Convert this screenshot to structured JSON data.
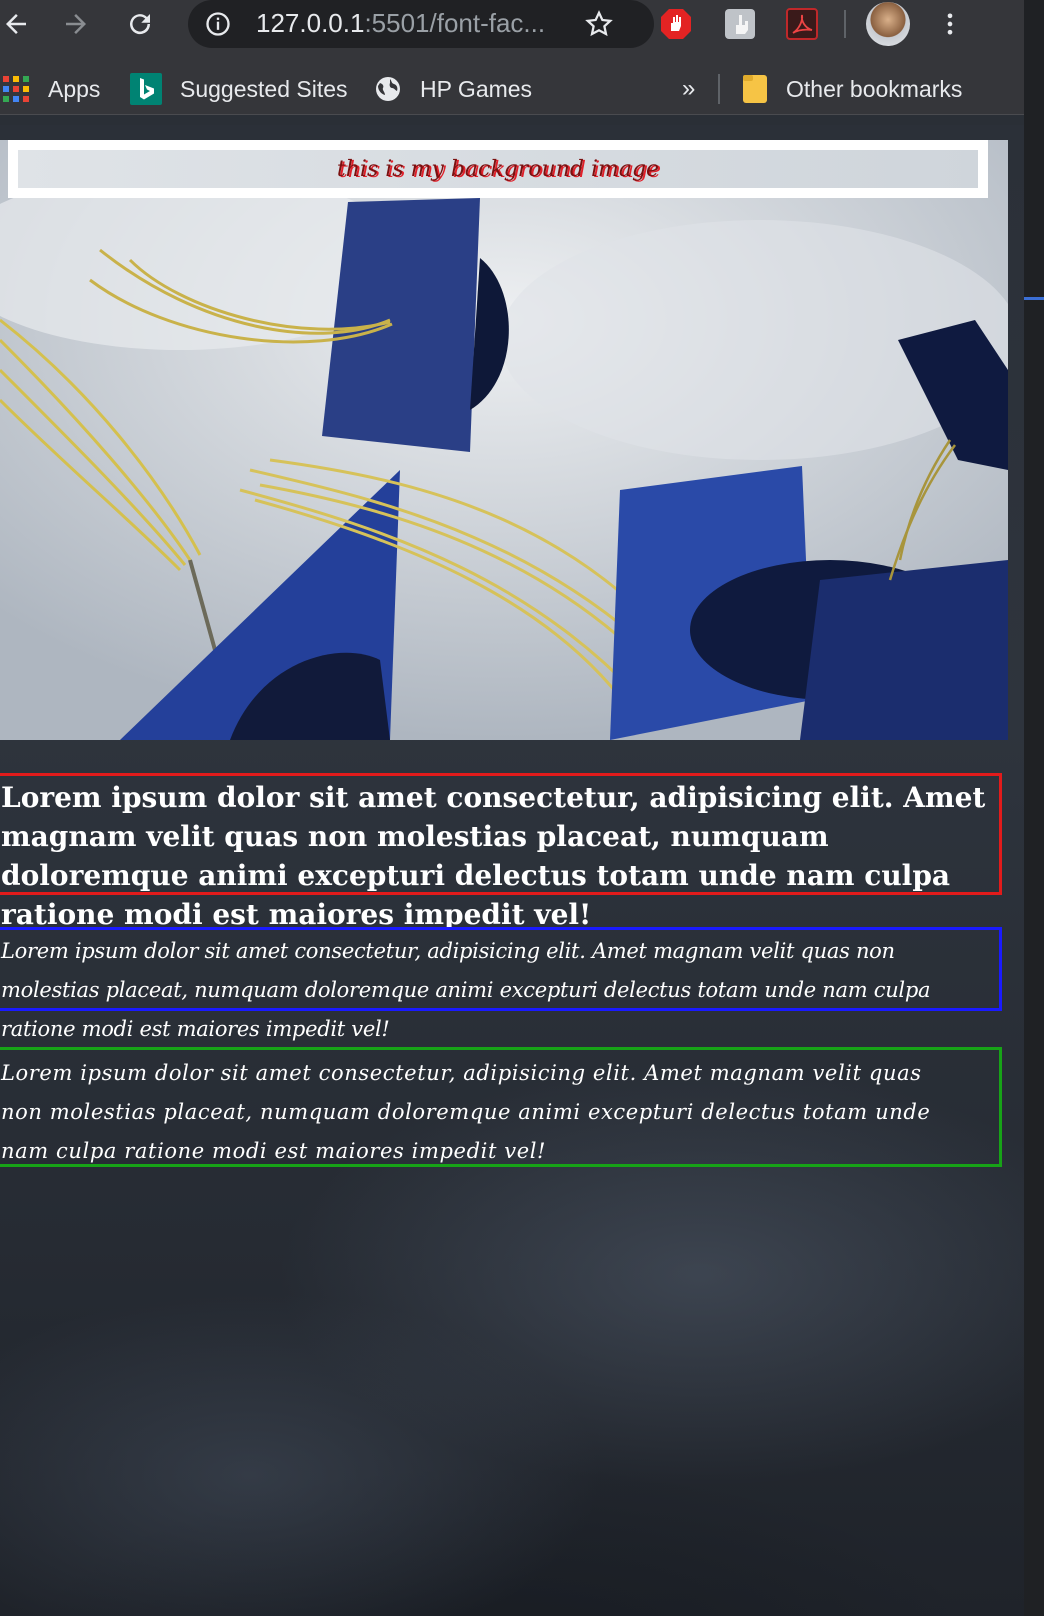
{
  "browser": {
    "url_host": "127.0.0.1",
    "url_rest": ":5501/font-fac...",
    "bookmarks": [
      {
        "label": "Apps",
        "icon": "apps-grid-icon"
      },
      {
        "label": "Suggested Sites",
        "icon": "bing-icon"
      },
      {
        "label": "HP Games",
        "icon": "globe-icon"
      }
    ],
    "overflow_label": "»",
    "other_bookmarks": "Other bookmarks"
  },
  "page": {
    "caption": "this is my background image",
    "paragraph_red": "Lorem ipsum dolor sit amet consectetur, adipisicing elit. Amet magnam velit quas non molestias placeat, numquam doloremque animi excepturi delectus totam unde nam culpa ratione modi est maiores impedit vel!",
    "paragraph_blue": "Lorem ipsum dolor sit amet consectetur, adipisicing elit. Amet magnam velit quas non molestias placeat, numquam doloremque animi excepturi delectus totam unde nam culpa ratione modi est maiores impedit vel!",
    "paragraph_green": "Lorem ipsum dolor sit amet consectetur, adipisicing elit. Amet magnam velit quas non molestias placeat, numquam doloremque animi excepturi delectus totam unde nam culpa ratione modi est maiores impedit vel!"
  },
  "colors": {
    "border_red": "#e21b1b",
    "border_blue": "#1a1aff",
    "border_green": "#17a317",
    "caption_shadow": "#e0202a"
  }
}
